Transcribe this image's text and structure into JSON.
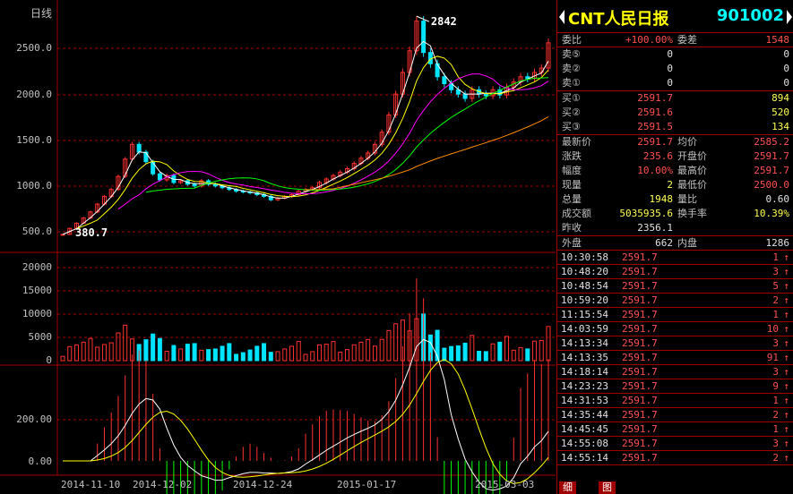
{
  "chart": {
    "title": "日线",
    "price_axis": [
      "2500.0",
      "2000.0",
      "1500.0",
      "1000.0",
      "500.0"
    ],
    "volume_axis": [
      "20000",
      "15000",
      "10000",
      "5000",
      "0"
    ],
    "macd_axis": [
      "200.00",
      "0.00"
    ],
    "dates": [
      "2014-11-10",
      "2014-12-02",
      "2014-12-24",
      "2015-01-17",
      "2015-03-03"
    ],
    "low_marker": "380.7",
    "high_marker": "2842"
  },
  "chart_data": {
    "type": "candlestick",
    "series": [
      {
        "name": "price",
        "values": [
          380.7,
          450,
          510,
          570,
          640,
          730,
          820,
          900,
          1050,
          1250,
          1420,
          1330,
          1220,
          1080,
          1010,
          1060,
          980,
          1000,
          960,
          940,
          1000,
          960,
          940,
          920,
          900,
          880,
          870,
          860,
          840,
          820,
          780,
          800,
          820,
          840,
          880,
          900,
          920,
          980,
          1020,
          1060,
          1100,
          1140,
          1200,
          1260,
          1320,
          1420,
          1560,
          1760,
          2000,
          2250,
          2500,
          2842,
          2480,
          2350,
          2200,
          2120,
          2050,
          2000,
          1950,
          2050,
          2000,
          1980,
          2050,
          1990,
          2080,
          2140,
          2200,
          2180,
          2250,
          2300,
          2591.7
        ]
      }
    ],
    "ylim": [
      380,
      2900
    ]
  },
  "quote": {
    "name": "CNT人民日报",
    "code": "901002",
    "weibi_label": "委比",
    "weibi_value": "+100.00%",
    "weicha_label": "委差",
    "weicha_value": "1548",
    "asks": [
      {
        "label": "卖⑤",
        "price": "0",
        "vol": "0"
      },
      {
        "label": "卖②",
        "price": "0",
        "vol": "0"
      },
      {
        "label": "卖①",
        "price": "0",
        "vol": "0"
      }
    ],
    "bids": [
      {
        "label": "买①",
        "price": "2591.7",
        "vol": "894"
      },
      {
        "label": "买②",
        "price": "2591.6",
        "vol": "520"
      },
      {
        "label": "买③",
        "price": "2591.5",
        "vol": "134"
      }
    ],
    "stats": [
      {
        "l1": "最新价",
        "v1": "2591.7",
        "l2": "均价",
        "v2": "2585.2"
      },
      {
        "l1": "涨跌",
        "v1": "235.6",
        "l2": "开盘价",
        "v2": "2591.7"
      },
      {
        "l1": "幅度",
        "v1": "10.00%",
        "l2": "最高价",
        "v2": "2591.7"
      },
      {
        "l1": "现量",
        "v1": "2",
        "l2": "最低价",
        "v2": "2500.0"
      },
      {
        "l1": "总量",
        "v1": "1948",
        "l2": "量比",
        "v2": "0.60"
      },
      {
        "l1": "成交额",
        "v1": "5035935.6",
        "l2": "换手率",
        "v2": "10.39%"
      },
      {
        "l1": "昨收",
        "v1": "2356.1",
        "l2": "",
        "v2": ""
      }
    ],
    "waipan_label": "外盘",
    "waipan_value": "662",
    "neipan_label": "内盘",
    "neipan_value": "1286",
    "ticks": [
      {
        "time": "10:30:58",
        "price": "2591.7",
        "vol": "1",
        "arrow": "↑"
      },
      {
        "time": "10:48:20",
        "price": "2591.7",
        "vol": "3",
        "arrow": "↑"
      },
      {
        "time": "10:48:54",
        "price": "2591.7",
        "vol": "5",
        "arrow": "↑"
      },
      {
        "time": "10:59:20",
        "price": "2591.7",
        "vol": "2",
        "arrow": "↑"
      },
      {
        "time": "11:15:54",
        "price": "2591.7",
        "vol": "1",
        "arrow": "↑"
      },
      {
        "time": "14:03:59",
        "price": "2591.7",
        "vol": "10",
        "arrow": "↑"
      },
      {
        "time": "14:13:34",
        "price": "2591.7",
        "vol": "3",
        "arrow": "↑"
      },
      {
        "time": "14:13:35",
        "price": "2591.7",
        "vol": "91",
        "arrow": "↑"
      },
      {
        "time": "14:18:14",
        "price": "2591.7",
        "vol": "3",
        "arrow": "↑"
      },
      {
        "time": "14:23:23",
        "price": "2591.7",
        "vol": "9",
        "arrow": "↑"
      },
      {
        "time": "14:31:53",
        "price": "2591.7",
        "vol": "1",
        "arrow": "↑"
      },
      {
        "time": "14:35:44",
        "price": "2591.7",
        "vol": "2",
        "arrow": "↑"
      },
      {
        "time": "14:45:45",
        "price": "2591.7",
        "vol": "1",
        "arrow": "↑"
      },
      {
        "time": "14:55:08",
        "price": "2591.7",
        "vol": "3",
        "arrow": "↑"
      },
      {
        "time": "14:55:14",
        "price": "2591.7",
        "vol": "2",
        "arrow": "↑"
      }
    ],
    "footer_tab1": "细",
    "footer_tab2": "图"
  }
}
